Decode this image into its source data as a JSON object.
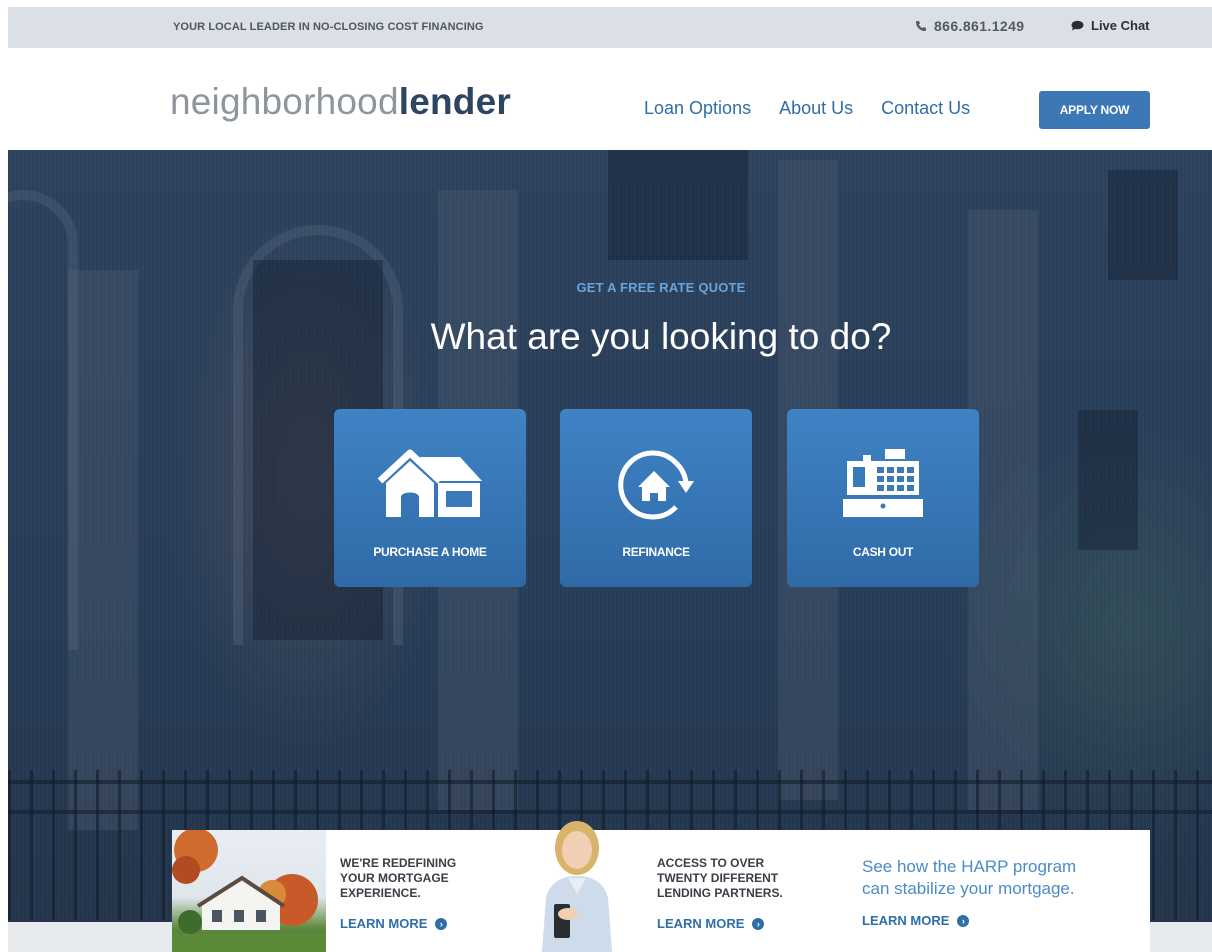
{
  "topbar": {
    "tagline": "YOUR LOCAL LEADER IN NO-CLOSING COST FINANCING",
    "phone": "866.861.1249",
    "chat": "Live Chat"
  },
  "header": {
    "logo_light": "neighborhood",
    "logo_bold": "lender",
    "nav": [
      "Loan Options",
      "About Us",
      "Contact Us"
    ],
    "apply": "APPLY NOW"
  },
  "hero": {
    "kicker": "GET A FREE RATE QUOTE",
    "headline": "What are you looking to do?",
    "options": [
      {
        "label": "PURCHASE A HOME",
        "icon": "house-icon"
      },
      {
        "label": "REFINANCE",
        "icon": "refinance-cycle-icon"
      },
      {
        "label": "CASH OUT",
        "icon": "cash-register-icon"
      }
    ]
  },
  "promo": {
    "block1": [
      "WE'RE REDEFINING",
      "YOUR MORTGAGE",
      "EXPERIENCE."
    ],
    "block1_link": "LEARN MORE",
    "block2": [
      "ACCESS TO OVER",
      "TWENTY DIFFERENT",
      "LENDING PARTNERS."
    ],
    "block2_link": "LEARN MORE",
    "harp": [
      "See how the HARP program",
      "can stabilize your mortgage."
    ],
    "harp_link": "LEARN MORE"
  },
  "colors": {
    "accent": "#3b78b5",
    "link": "#2f6ea7",
    "hero_overlay": "#2f4561"
  }
}
